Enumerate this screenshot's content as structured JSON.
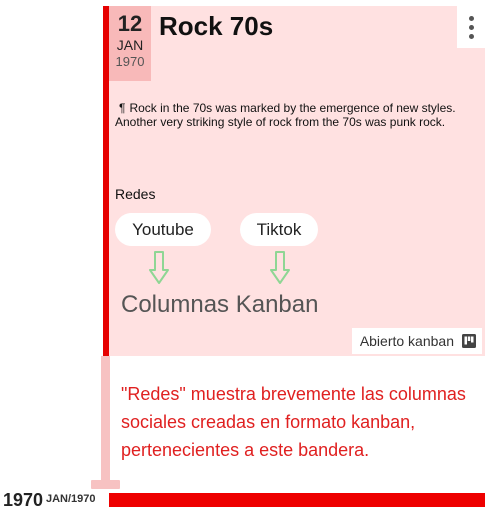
{
  "event": {
    "date_day": "12",
    "date_month": "JAN",
    "date_year": "1970",
    "title": "Rock 70s",
    "pilcrow": "¶",
    "description": "Rock in the 70s was marked by the emergence of new styles. Another very striking style of rock from the 70s was punk rock.",
    "section_label": "Redes",
    "networks": [
      "Youtube",
      "Tiktok"
    ],
    "kanban_heading": "Columnas Kanban",
    "status": "Abierto kanban"
  },
  "annotation": "\"Redes\" muestra brevemente las columnas sociales creadas en formato kanban, pertenecientes a este bandera.",
  "timeline": {
    "year": "1970",
    "year_sub": "JAN/1970"
  },
  "colors": {
    "timeline_red": "#e60000",
    "card_bg": "#ffe1e1",
    "date_bg": "#f8b9b9",
    "annotation_red": "#e02020",
    "arrow_green": "#8fd694"
  },
  "icons": [
    "kebab-menu-icon",
    "down-arrow-icon",
    "kanban-icon"
  ]
}
